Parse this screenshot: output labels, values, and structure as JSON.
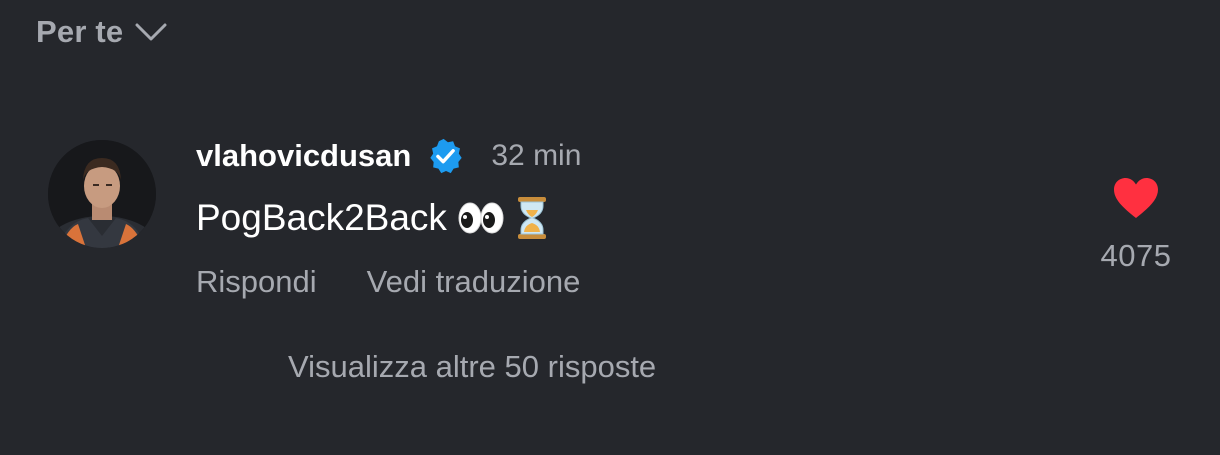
{
  "header": {
    "sort_label": "Per te",
    "sort_icon": "chevron-down-icon"
  },
  "comment": {
    "username": "vlahovicdusan",
    "verified": true,
    "verified_icon": "verified-badge-icon",
    "timestamp": "32 min",
    "text": "PogBack2Back",
    "emojis": [
      "eyes-emoji",
      "hourglass-emoji"
    ],
    "actions": {
      "reply": "Rispondi",
      "translate": "Vedi traduzione"
    },
    "likes": {
      "count": "4075",
      "liked": true,
      "icon": "heart-icon",
      "color": "#ff3040"
    },
    "view_replies": "Visualizza altre 50 risposte"
  },
  "colors": {
    "background": "#25272c",
    "secondary_text": "#a6a9b0",
    "primary_text": "#ffffff",
    "verified_blue": "#1d9bf0"
  }
}
